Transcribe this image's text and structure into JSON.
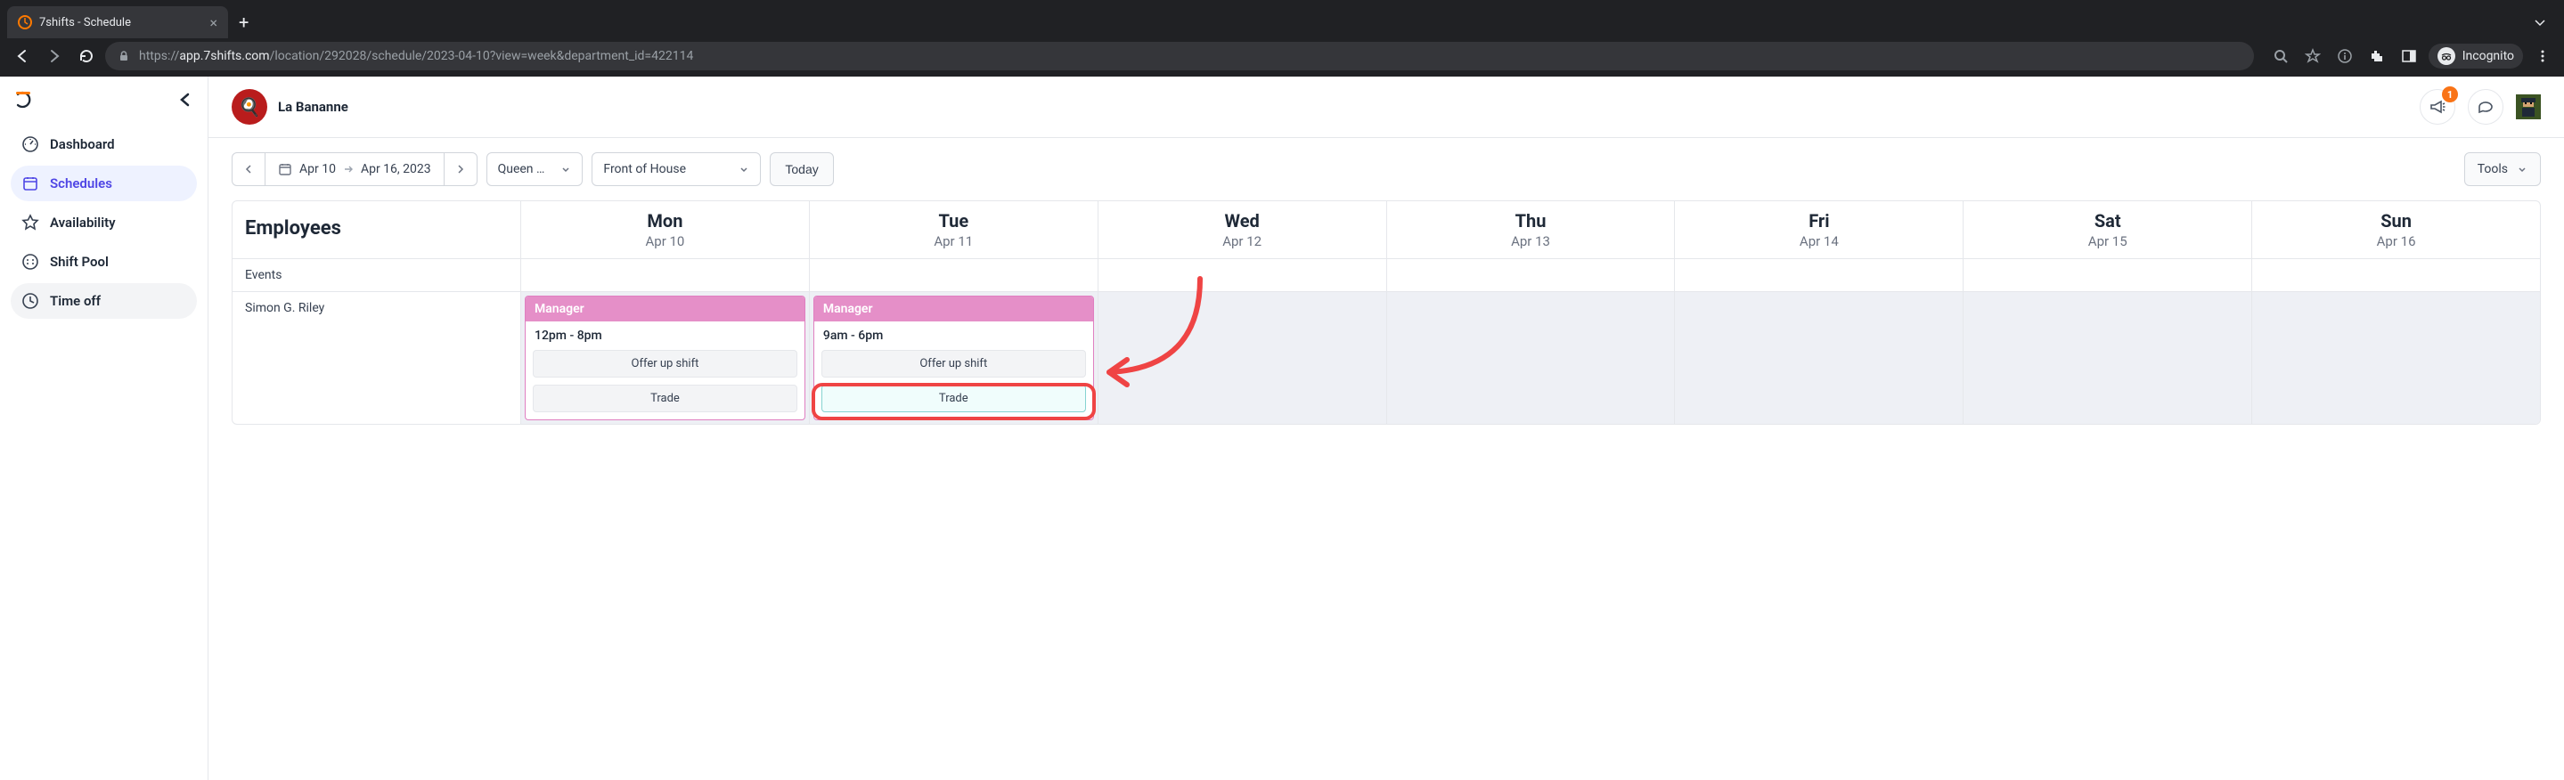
{
  "browser": {
    "tab_title": "7shifts - Schedule",
    "url_scheme": "https://",
    "url_domain": "app.7shifts.com",
    "url_path": "/location/292028/schedule/2023-04-10?view=week&department_id=422114",
    "incognito_label": "Incognito"
  },
  "sidebar": {
    "items": [
      {
        "label": "Dashboard"
      },
      {
        "label": "Schedules"
      },
      {
        "label": "Availability"
      },
      {
        "label": "Shift Pool"
      },
      {
        "label": "Time off"
      }
    ]
  },
  "header": {
    "location_name": "La Bananne",
    "notification_count": "1"
  },
  "toolbar": {
    "date_start": "Apr 10",
    "date_end": "Apr 16, 2023",
    "location_filter": "Queen …",
    "department_filter": "Front of House",
    "today_label": "Today",
    "tools_label": "Tools"
  },
  "schedule": {
    "employees_header": "Employees",
    "days": [
      {
        "dow": "Mon",
        "date": "Apr 10"
      },
      {
        "dow": "Tue",
        "date": "Apr 11"
      },
      {
        "dow": "Wed",
        "date": "Apr 12"
      },
      {
        "dow": "Thu",
        "date": "Apr 13"
      },
      {
        "dow": "Fri",
        "date": "Apr 14"
      },
      {
        "dow": "Sat",
        "date": "Apr 15"
      },
      {
        "dow": "Sun",
        "date": "Apr 16"
      }
    ],
    "events_label": "Events",
    "employee_rows": [
      {
        "name": "Simon G. Riley",
        "shifts": [
          {
            "day": 0,
            "role": "Manager",
            "time": "12pm - 8pm",
            "offer_label": "Offer up shift",
            "trade_label": "Trade"
          },
          {
            "day": 1,
            "role": "Manager",
            "time": "9am - 6pm",
            "offer_label": "Offer up shift",
            "trade_label": "Trade"
          }
        ]
      }
    ]
  }
}
